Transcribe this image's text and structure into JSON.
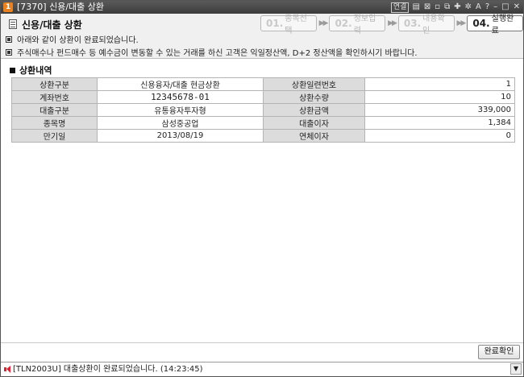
{
  "window": {
    "number": "1",
    "title": "[7370] 신용/대출 상환",
    "tools": {
      "link": "연결"
    }
  },
  "header": {
    "title": "신용/대출 상환",
    "steps": [
      {
        "num": "01.",
        "label": "종목선택"
      },
      {
        "num": "02.",
        "label": "정보입력"
      },
      {
        "num": "03.",
        "label": "내용확인"
      },
      {
        "num": "04.",
        "label": "실행완료"
      }
    ],
    "notices": [
      "아래와 같이 상환이 완료되었습니다.",
      "주식매수나 펀드매수 등 예수금이 변동할 수 있는 거래를 하신 고객은 익일정산액, D+2 정산액을 확인하시기 바랍니다."
    ]
  },
  "section": {
    "title": "상환내역"
  },
  "table": {
    "rows": [
      {
        "l1": "상환구분",
        "v1": "신용융자/대출 현금상환",
        "l2": "상환일련번호",
        "v2": "1"
      },
      {
        "l1": "계좌번호",
        "v1": "12345678-01",
        "l2": "상환수량",
        "v2": "10"
      },
      {
        "l1": "대출구분",
        "v1": "유통융자투자형",
        "l2": "상환금액",
        "v2": "339,000"
      },
      {
        "l1": "종목명",
        "v1": "삼성중공업",
        "l2": "대출이자",
        "v2": "1,384"
      },
      {
        "l1": "만기일",
        "v1": "2013/08/19",
        "l2": "연체이자",
        "v2": "0"
      }
    ]
  },
  "buttons": {
    "done": "완료확인"
  },
  "status": {
    "message": "[TLN2003U] 대출상환이 완료되었습니다. (14:23:45)"
  }
}
